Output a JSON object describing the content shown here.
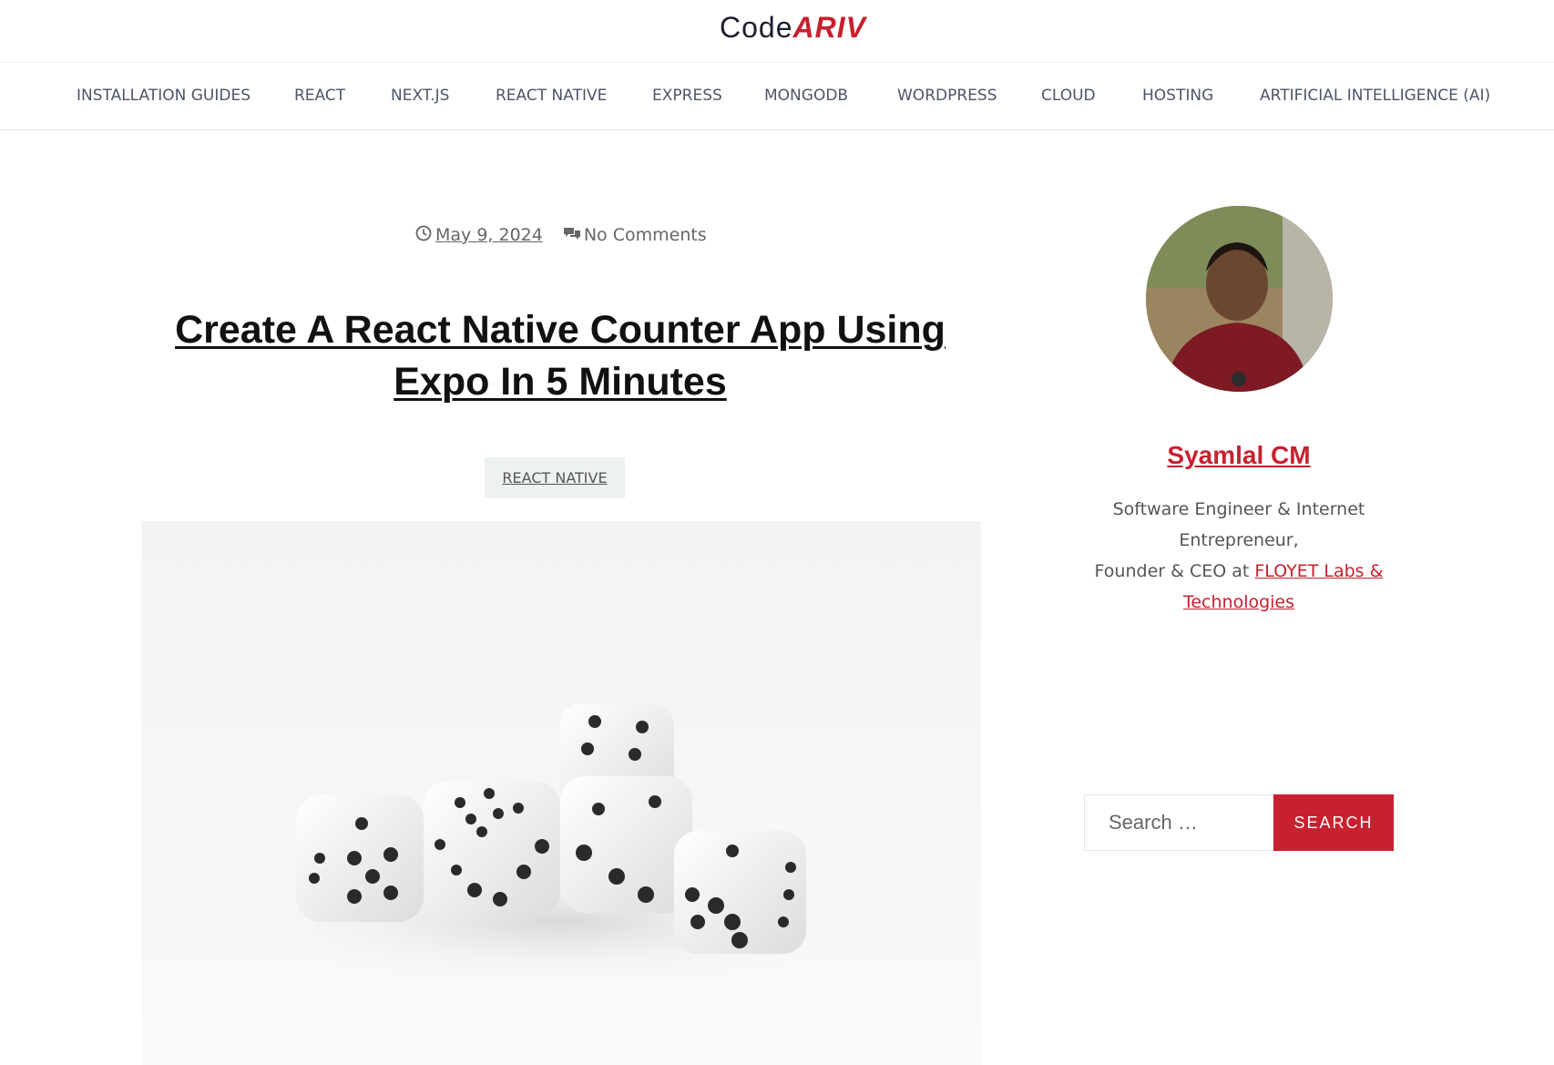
{
  "site": {
    "logo_part1": "Code",
    "logo_part2": "ARIV",
    "brand_color": "#c8202f"
  },
  "nav": {
    "items": [
      {
        "label": "INSTALLATION GUIDES"
      },
      {
        "label": "REACT"
      },
      {
        "label": "NEXT.JS"
      },
      {
        "label": "REACT NATIVE"
      },
      {
        "label": "EXPRESS"
      },
      {
        "label": "MONGODB"
      },
      {
        "label": "WORDPRESS"
      },
      {
        "label": "CLOUD"
      },
      {
        "label": "HOSTING"
      },
      {
        "label": "ARTIFICIAL INTELLIGENCE (AI)"
      }
    ]
  },
  "post": {
    "date": "May 9, 2024",
    "comments": "No Comments",
    "title_line1": "Create A React Native Counter App Using",
    "title_line2": "Expo In 5 Minutes",
    "category": "REACT NATIVE",
    "hero_icon": "dice-image"
  },
  "sidebar": {
    "author_name": "Syamlal CM",
    "bio_line1": "Software Engineer & Internet",
    "bio_line2": "Entrepreneur,",
    "bio_prefix": "Founder & CEO at ",
    "bio_link_line1": "FLOYET Labs &",
    "bio_link_line2": "Technologies",
    "search_placeholder": "Search …",
    "search_button": "SEARCH"
  }
}
